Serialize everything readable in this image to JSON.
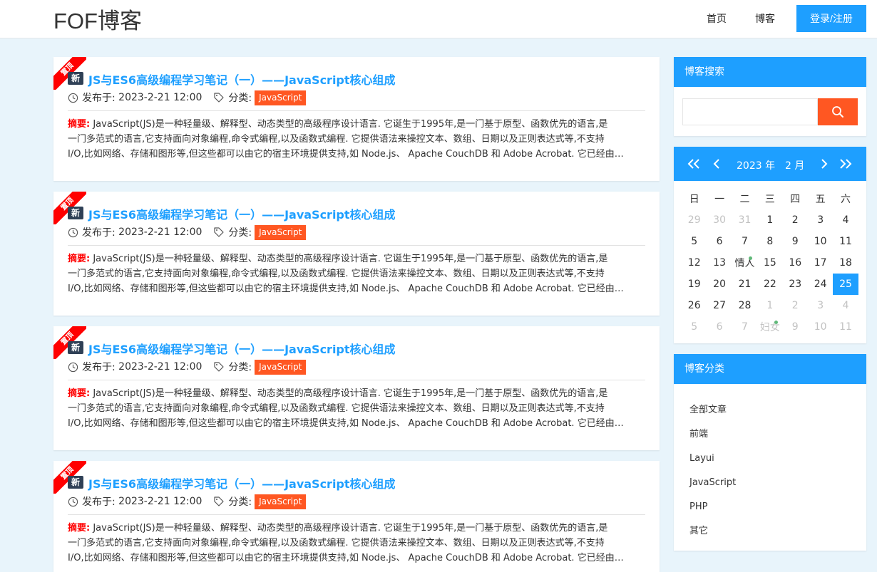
{
  "header": {
    "logo": "FOF博客",
    "nav": [
      "首页",
      "博客"
    ],
    "login_label": "登录/注册"
  },
  "colors": {
    "accent": "#1e9fff",
    "tag": "#ff5722",
    "ribbon": "#ff0000",
    "badge": "#2f4056"
  },
  "posts": [
    {
      "ribbon": "置顶",
      "badge": "新",
      "title": "JS与ES6高级编程学习笔记（一）——JavaScript核心组成",
      "date_label": "发布于:",
      "date": "2023-2-21 12:00",
      "cat_label": "分类:",
      "category": "JavaScript",
      "summary_label": "摘要:",
      "summary_lines": [
        "JavaScript(JS)是一种轻量级、解释型、动态类型的高级程序设计语言. 它诞生于1995年,是一门基于原型、函数优先的语言,是",
        "一门多范式的语言,它支持面向对象编程,命令式编程,以及函数式编程. 它提供语法来操控文本、数组、日期以及正则表达式等,不支持",
        "I/O,比如网络、存储和图形等,但这些都可以由它的宿主环境提供支持,如 Node.js、 Apache CouchDB 和 Adobe Acrobat. 它已经由…"
      ]
    },
    {
      "ribbon": "置顶",
      "badge": "新",
      "title": "JS与ES6高级编程学习笔记（一）——JavaScript核心组成",
      "date_label": "发布于:",
      "date": "2023-2-21 12:00",
      "cat_label": "分类:",
      "category": "JavaScript",
      "summary_label": "摘要:",
      "summary_lines": [
        "JavaScript(JS)是一种轻量级、解释型、动态类型的高级程序设计语言. 它诞生于1995年,是一门基于原型、函数优先的语言,是",
        "一门多范式的语言,它支持面向对象编程,命令式编程,以及函数式编程. 它提供语法来操控文本、数组、日期以及正则表达式等,不支持",
        "I/O,比如网络、存储和图形等,但这些都可以由它的宿主环境提供支持,如 Node.js、 Apache CouchDB 和 Adobe Acrobat. 它已经由…"
      ]
    },
    {
      "ribbon": "置顶",
      "badge": "新",
      "title": "JS与ES6高级编程学习笔记（一）——JavaScript核心组成",
      "date_label": "发布于:",
      "date": "2023-2-21 12:00",
      "cat_label": "分类:",
      "category": "JavaScript",
      "summary_label": "摘要:",
      "summary_lines": [
        "JavaScript(JS)是一种轻量级、解释型、动态类型的高级程序设计语言. 它诞生于1995年,是一门基于原型、函数优先的语言,是",
        "一门多范式的语言,它支持面向对象编程,命令式编程,以及函数式编程. 它提供语法来操控文本、数组、日期以及正则表达式等,不支持",
        "I/O,比如网络、存储和图形等,但这些都可以由它的宿主环境提供支持,如 Node.js、 Apache CouchDB 和 Adobe Acrobat. 它已经由…"
      ]
    },
    {
      "ribbon": "置顶",
      "badge": "新",
      "title": "JS与ES6高级编程学习笔记（一）——JavaScript核心组成",
      "date_label": "发布于:",
      "date": "2023-2-21 12:00",
      "cat_label": "分类:",
      "category": "JavaScript",
      "summary_label": "摘要:",
      "summary_lines": [
        "JavaScript(JS)是一种轻量级、解释型、动态类型的高级程序设计语言. 它诞生于1995年,是一门基于原型、函数优先的语言,是",
        "一门多范式的语言,它支持面向对象编程,命令式编程,以及函数式编程. 它提供语法来操控文本、数组、日期以及正则表达式等,不支持",
        "I/O,比如网络、存储和图形等,但这些都可以由它的宿主环境提供支持,如 Node.js、 Apache CouchDB 和 Adobe Acrobat. 它已经由…"
      ]
    }
  ],
  "search": {
    "title": "博客搜索",
    "placeholder": "",
    "value": ""
  },
  "calendar": {
    "year": "2023 年",
    "month": "2 月",
    "weekdays": [
      "日",
      "一",
      "二",
      "三",
      "四",
      "五",
      "六"
    ],
    "weeks": [
      [
        {
          "t": "29",
          "dim": true
        },
        {
          "t": "30",
          "dim": true
        },
        {
          "t": "31",
          "dim": true
        },
        {
          "t": "1"
        },
        {
          "t": "2"
        },
        {
          "t": "3"
        },
        {
          "t": "4"
        }
      ],
      [
        {
          "t": "5"
        },
        {
          "t": "6"
        },
        {
          "t": "7"
        },
        {
          "t": "8"
        },
        {
          "t": "9"
        },
        {
          "t": "10"
        },
        {
          "t": "11"
        }
      ],
      [
        {
          "t": "12"
        },
        {
          "t": "13"
        },
        {
          "t": "情人",
          "mark": true
        },
        {
          "t": "15"
        },
        {
          "t": "16"
        },
        {
          "t": "17"
        },
        {
          "t": "18"
        }
      ],
      [
        {
          "t": "19"
        },
        {
          "t": "20"
        },
        {
          "t": "21"
        },
        {
          "t": "22"
        },
        {
          "t": "23"
        },
        {
          "t": "24"
        },
        {
          "t": "25",
          "today": true
        }
      ],
      [
        {
          "t": "26"
        },
        {
          "t": "27"
        },
        {
          "t": "28"
        },
        {
          "t": "1",
          "dim": true
        },
        {
          "t": "2",
          "dim": true
        },
        {
          "t": "3",
          "dim": true
        },
        {
          "t": "4",
          "dim": true
        }
      ],
      [
        {
          "t": "5",
          "dim": true
        },
        {
          "t": "6",
          "dim": true
        },
        {
          "t": "7",
          "dim": true
        },
        {
          "t": "妇女",
          "dim": true,
          "mark": true
        },
        {
          "t": "9",
          "dim": true
        },
        {
          "t": "10",
          "dim": true
        },
        {
          "t": "11",
          "dim": true
        }
      ]
    ]
  },
  "categories": {
    "title": "博客分类",
    "items": [
      "全部文章",
      "前端",
      "Layui",
      "JavaScript",
      "PHP",
      "其它"
    ]
  }
}
